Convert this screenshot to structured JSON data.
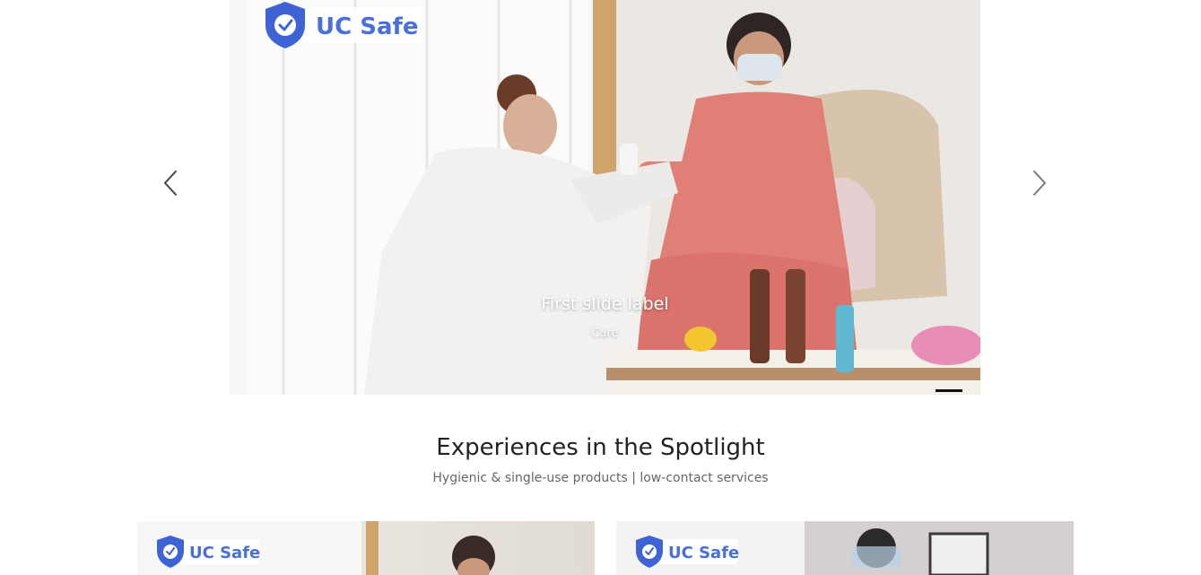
{
  "carousel": {
    "slide": {
      "badge_text": "UC Safe",
      "caption_title": "First slide label",
      "caption_text": "Care"
    },
    "prev_icon": "chevron-left-icon",
    "next_icon": "chevron-right-icon",
    "active_index": 1,
    "total_slides": 1
  },
  "spotlight": {
    "title": "Experiences in the Spotlight",
    "subtitle": "Hygienic & single-use products | low-contact services",
    "cards": [
      {
        "badge_text": "UC Safe"
      },
      {
        "badge_text": "UC Safe"
      }
    ]
  },
  "colors": {
    "badge_blue": "#4a6fd8",
    "indicator": "#111111",
    "title_text": "#222222",
    "subtitle_text": "#666666"
  }
}
